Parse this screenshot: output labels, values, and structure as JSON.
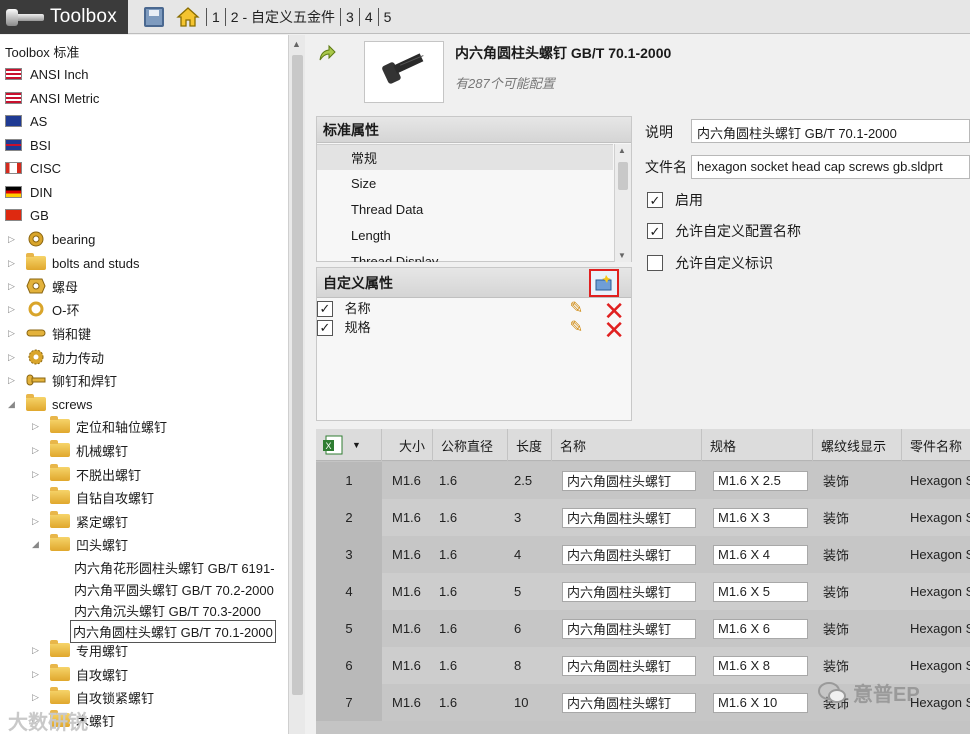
{
  "topbar": {
    "app_title": "Toolbox",
    "breadcrumbs": [
      "1",
      "2 - 自定义五金件",
      "3",
      "4",
      "5"
    ]
  },
  "tree": {
    "root_label": "Toolbox 标准",
    "standards": [
      {
        "label": "ANSI Inch",
        "flag": "us"
      },
      {
        "label": "ANSI Metric",
        "flag": "us"
      },
      {
        "label": "AS",
        "flag": "au"
      },
      {
        "label": "BSI",
        "flag": "gb"
      },
      {
        "label": "CISC",
        "flag": "ca"
      },
      {
        "label": "DIN",
        "flag": "de"
      },
      {
        "label": "GB",
        "flag": "cn"
      }
    ],
    "gb_categories": [
      {
        "label": "bearing",
        "icon": "bearing-icon"
      },
      {
        "label": "bolts and studs",
        "icon": "bolt-icon"
      },
      {
        "label": "螺母",
        "icon": "nut-icon"
      },
      {
        "label": "O-环",
        "icon": "o-ring-icon"
      },
      {
        "label": "销和键",
        "icon": "pin-icon"
      },
      {
        "label": "动力传动",
        "icon": "gear-icon"
      },
      {
        "label": "铆钉和焊钉",
        "icon": "rivet-icon"
      },
      {
        "label": "screws",
        "icon": "screw-icon"
      }
    ],
    "screw_subcategories": [
      "定位和轴位螺钉",
      "机械螺钉",
      "不脱出螺钉",
      "自钻自攻螺钉",
      "紧定螺钉",
      "凹头螺钉"
    ],
    "recess_items": [
      "内六角花形圆柱头螺钉 GB/T 6191-",
      "内六角平圆头螺钉 GB/T 70.2-2000",
      "内六角沉头螺钉 GB/T 70.3-2000",
      "内六角圆柱头螺钉 GB/T 70.1-2000"
    ],
    "more_subcategories": [
      "专用螺钉",
      "自攻螺钉",
      "自攻锁紧螺钉",
      "木螺钉"
    ]
  },
  "part": {
    "title": "内六角圆柱头螺钉 GB/T 70.1-2000",
    "subtitle": "有287个可能配置"
  },
  "standard_props": {
    "header": "标准属性",
    "items": [
      "常规",
      "Size",
      "Thread Data",
      "Length",
      "Thread Display"
    ]
  },
  "custom_props": {
    "header": "自定义属性",
    "items": [
      {
        "label": "名称",
        "checked": true
      },
      {
        "label": "规格",
        "checked": true
      }
    ]
  },
  "form": {
    "desc_label": "说明",
    "desc_value": "内六角圆柱头螺钉 GB/T 70.1-2000",
    "file_label": "文件名",
    "file_value": "hexagon socket head cap screws gb.sldprt",
    "checks": [
      {
        "label": "启用",
        "checked": true
      },
      {
        "label": "允许自定义配置名称",
        "checked": true
      },
      {
        "label": "允许自定义标识",
        "checked": false
      }
    ]
  },
  "table": {
    "columns": [
      "大小",
      "公称直径",
      "长度",
      "名称",
      "规格",
      "螺纹线显示",
      "零件名称"
    ],
    "rows": [
      {
        "n": "1",
        "size": "M1.6",
        "dia": "1.6",
        "len": "2.5",
        "name": "内六角圆柱头螺钉",
        "spec": "M1.6 X 2.5",
        "thread": "装饰",
        "part": "Hexagon S"
      },
      {
        "n": "2",
        "size": "M1.6",
        "dia": "1.6",
        "len": "3",
        "name": "内六角圆柱头螺钉",
        "spec": "M1.6 X 3",
        "thread": "装饰",
        "part": "Hexagon S"
      },
      {
        "n": "3",
        "size": "M1.6",
        "dia": "1.6",
        "len": "4",
        "name": "内六角圆柱头螺钉",
        "spec": "M1.6 X 4",
        "thread": "装饰",
        "part": "Hexagon S"
      },
      {
        "n": "4",
        "size": "M1.6",
        "dia": "1.6",
        "len": "5",
        "name": "内六角圆柱头螺钉",
        "spec": "M1.6 X 5",
        "thread": "装饰",
        "part": "Hexagon S"
      },
      {
        "n": "5",
        "size": "M1.6",
        "dia": "1.6",
        "len": "6",
        "name": "内六角圆柱头螺钉",
        "spec": "M1.6 X 6",
        "thread": "装饰",
        "part": "Hexagon S"
      },
      {
        "n": "6",
        "size": "M1.6",
        "dia": "1.6",
        "len": "8",
        "name": "内六角圆柱头螺钉",
        "spec": "M1.6 X 8",
        "thread": "装饰",
        "part": "Hexagon S"
      },
      {
        "n": "7",
        "size": "M1.6",
        "dia": "1.6",
        "len": "10",
        "name": "内六角圆柱头螺钉",
        "spec": "M1.6 X 10",
        "thread": "装饰",
        "part": "Hexagon S"
      }
    ]
  },
  "watermarks": {
    "left": "大数研锐",
    "right": "意普EP"
  }
}
